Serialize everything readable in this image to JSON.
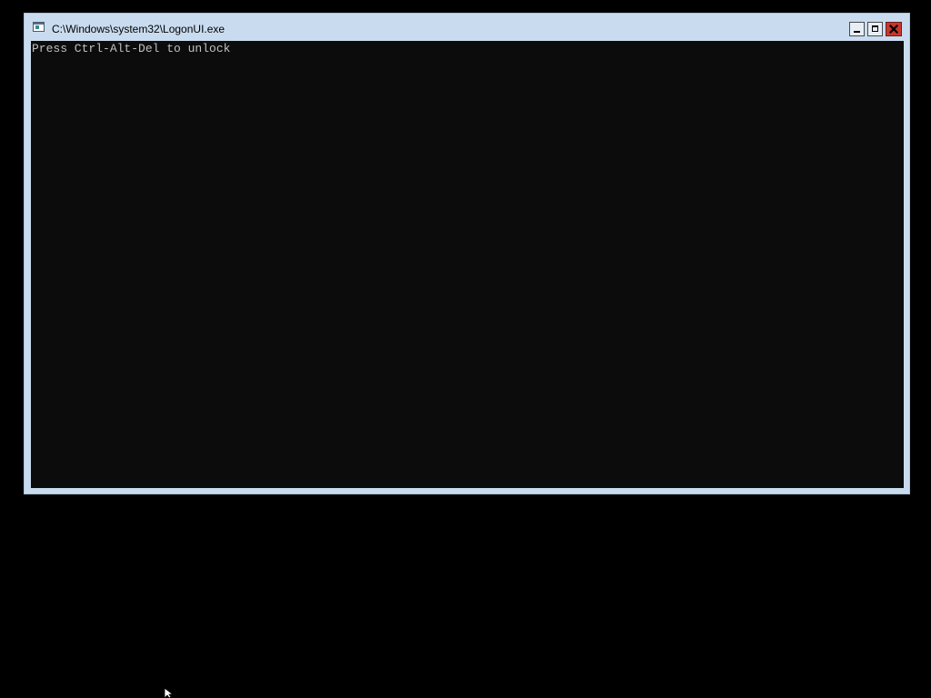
{
  "window": {
    "title": "C:\\Windows\\system32\\LogonUI.exe",
    "icon": "console-app-icon",
    "controls": {
      "minimize": "minimize-icon",
      "maximize": "maximize-icon",
      "close": "close-icon"
    },
    "colors": {
      "frame": "#c9dcef",
      "console_bg": "#0c0c0c",
      "console_text": "#c0c0c0",
      "close_button": "#c8382d"
    }
  },
  "console": {
    "lines": [
      "Press Ctrl-Alt-Del to unlock"
    ]
  },
  "desktop": {
    "background": "#000000",
    "pointer": "mouse-pointer-icon"
  }
}
